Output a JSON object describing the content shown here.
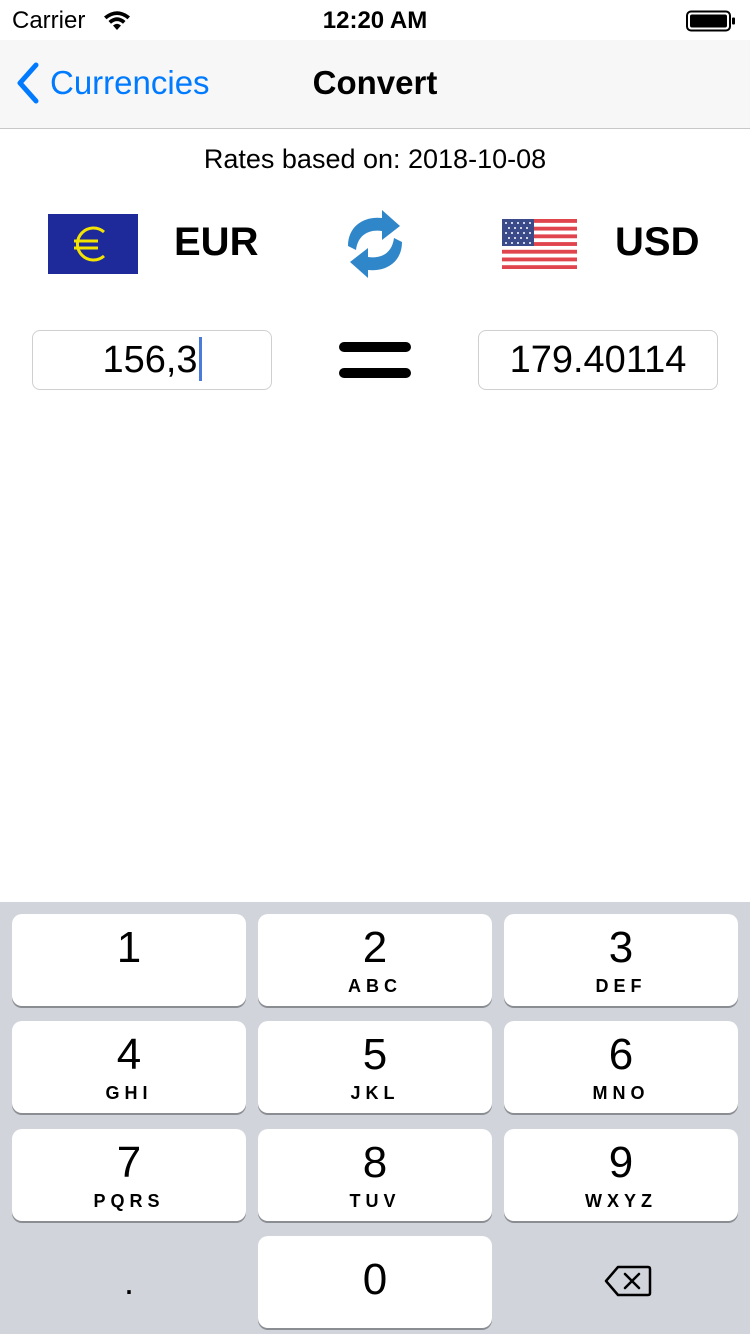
{
  "status_bar": {
    "carrier": "Carrier",
    "time": "12:20 AM"
  },
  "nav": {
    "back_label": "Currencies",
    "title": "Convert",
    "accent_color": "#007aff"
  },
  "rates": {
    "text": "Rates based on: 2018-10-08"
  },
  "from_currency": {
    "code": "EUR",
    "flag_icon": "eu-flag-icon",
    "amount": "156,3"
  },
  "to_currency": {
    "code": "USD",
    "flag_icon": "us-flag-icon",
    "amount": "179.40114"
  },
  "swap_icon": "swap-arrows-icon",
  "keypad": {
    "keys": [
      {
        "digit": "1",
        "letters": ""
      },
      {
        "digit": "2",
        "letters": "ABC"
      },
      {
        "digit": "3",
        "letters": "DEF"
      },
      {
        "digit": "4",
        "letters": "GHI"
      },
      {
        "digit": "5",
        "letters": "JKL"
      },
      {
        "digit": "6",
        "letters": "MNO"
      },
      {
        "digit": "7",
        "letters": "PQRS"
      },
      {
        "digit": "8",
        "letters": "TUV"
      },
      {
        "digit": "9",
        "letters": "WXYZ"
      }
    ],
    "decimal": ".",
    "zero": "0",
    "delete_icon": "backspace-icon"
  }
}
